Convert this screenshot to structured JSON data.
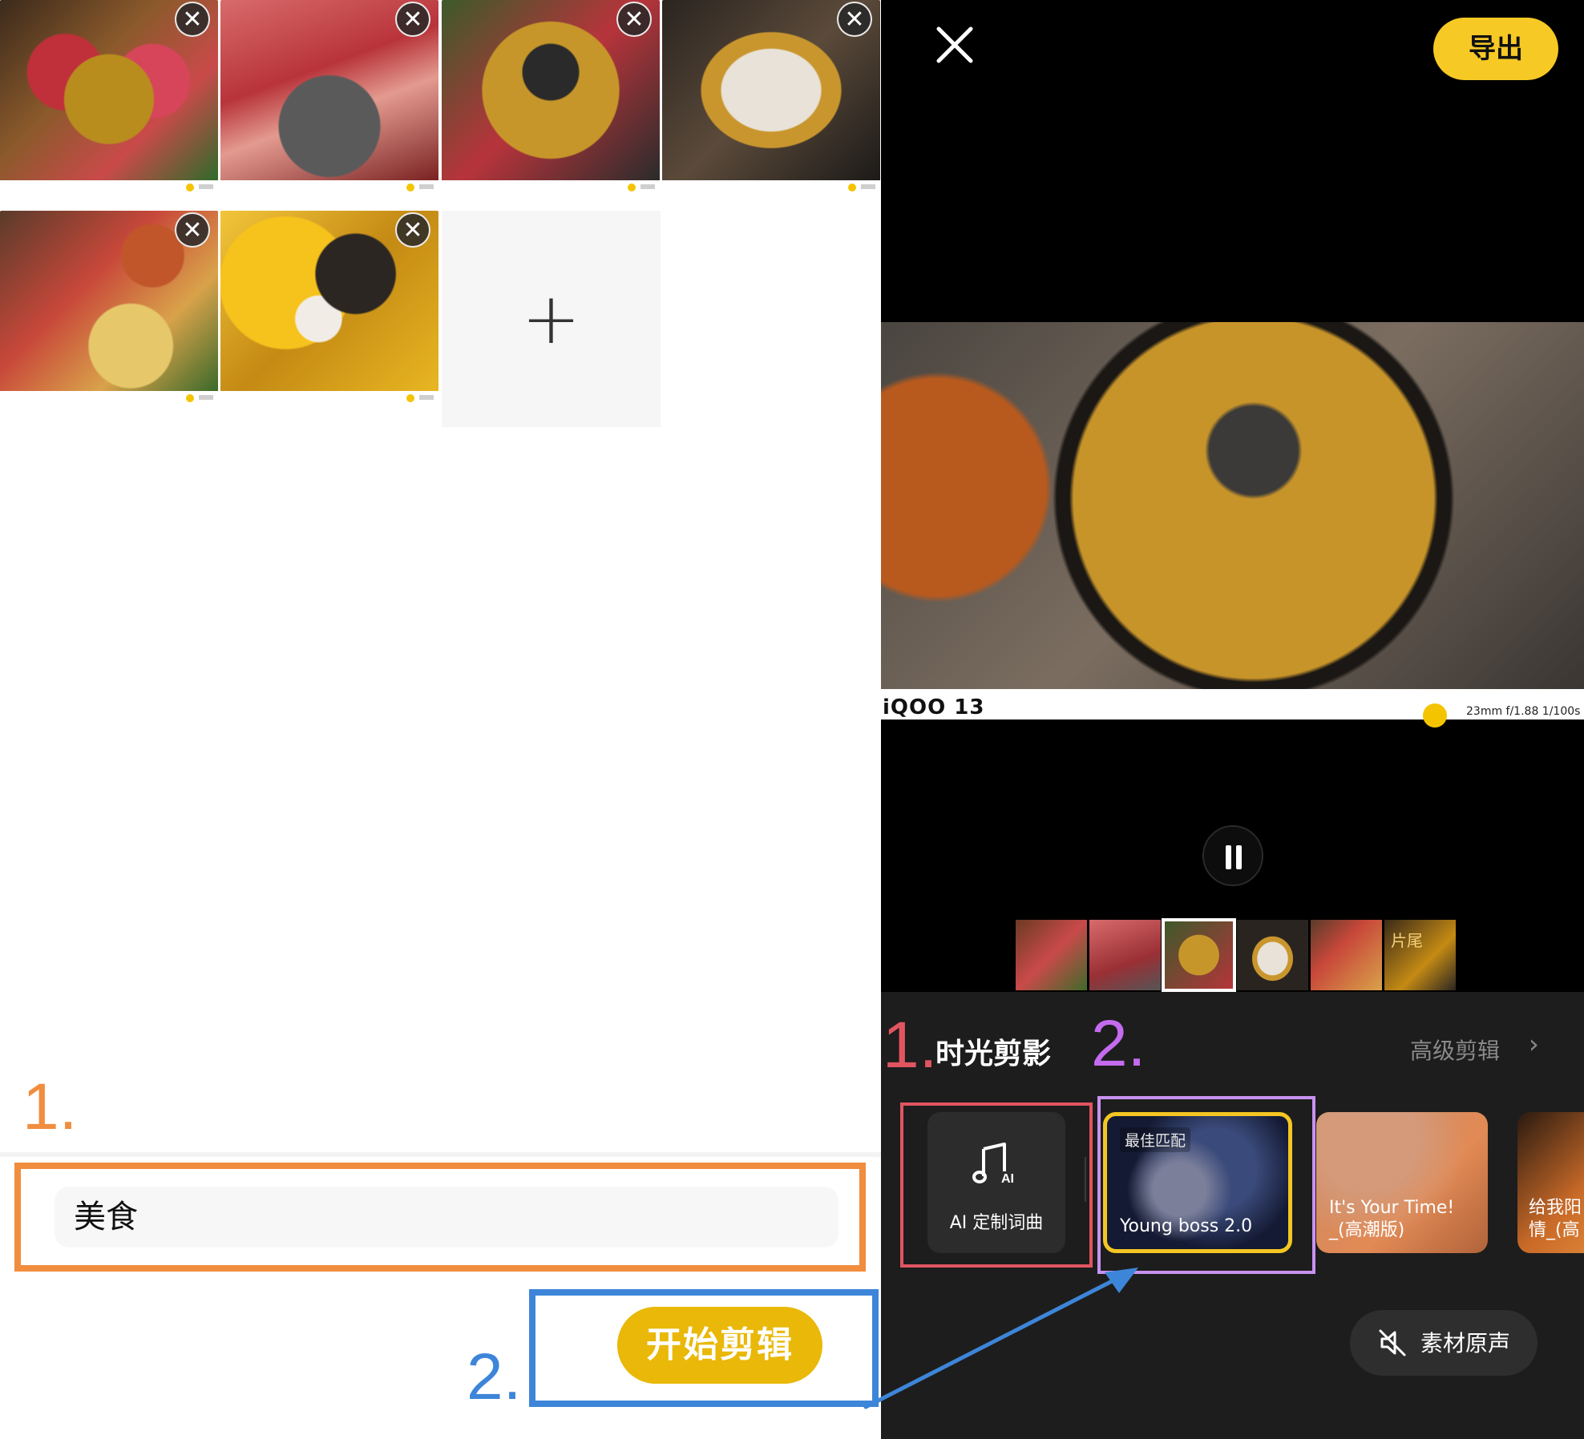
{
  "left": {
    "search_input_value": "美食",
    "start_button_label": "开始剪辑",
    "remove_icon": "close-icon",
    "add_icon": "+",
    "annotation_1": "1.",
    "annotation_2": "2."
  },
  "right": {
    "export_label": "导出",
    "close_icon": "close-icon",
    "mode_title": "时光剪影",
    "advanced_label": "高级剪辑",
    "advanced_chevron": "›",
    "exif_brand": "iQOO 13",
    "exif_params": "23mm f/1.88 1/100s",
    "timeline_end_tag": "片尾",
    "ai_card_label": "AI 定制词曲",
    "music_cards": [
      {
        "badge": "最佳匹配",
        "name": "Young boss 2.0"
      },
      {
        "name": "It's Your Time!\n_(高潮版)"
      },
      {
        "name": "给我阳\n情_(高"
      }
    ],
    "mute_label": "素材原声",
    "annotation_1": "1.",
    "annotation_2": "2."
  },
  "colors": {
    "accent_yellow": "#f7c925",
    "start_button": "#e9b808",
    "annotation_orange": "#f08d3e",
    "annotation_blue": "#3d85d8",
    "annotation_red": "#e15561",
    "annotation_purple": "#c56bf0"
  }
}
